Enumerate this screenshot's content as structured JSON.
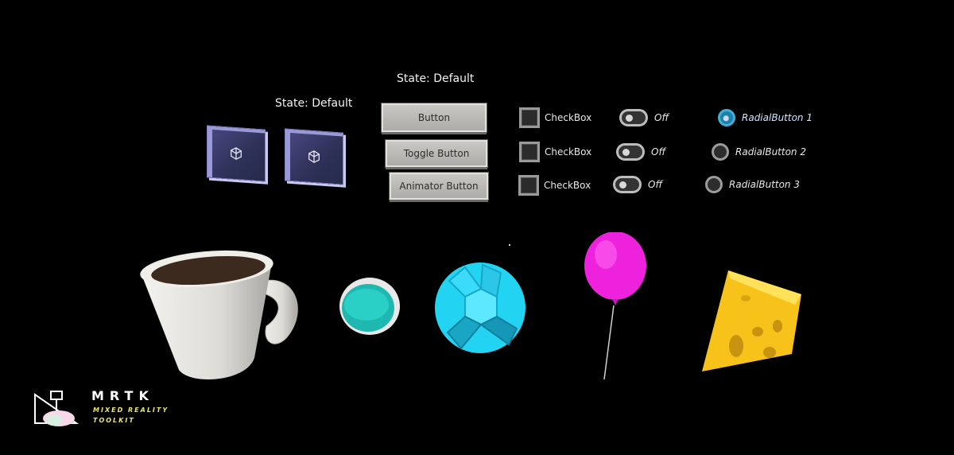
{
  "state_labels": {
    "tiles": "State: Default",
    "buttons": "State: Default"
  },
  "tiles": [
    {
      "icon": "cube-icon"
    },
    {
      "icon": "cube-icon"
    }
  ],
  "buttons": {
    "button": "Button",
    "toggle": "Toggle Button",
    "animator": "Animator Button"
  },
  "checkboxes": [
    "CheckBox",
    "CheckBox",
    "CheckBox"
  ],
  "toggles": [
    "Off",
    "Off",
    "Off"
  ],
  "radials": [
    {
      "label": "RadialButton 1",
      "selected": true
    },
    {
      "label": "RadialButton 2",
      "selected": false
    },
    {
      "label": "RadialButton 3",
      "selected": false
    }
  ],
  "objects": [
    "coffee-cup",
    "push-button",
    "icosphere",
    "balloon",
    "cheese"
  ],
  "logo": {
    "title": "MRTK",
    "subtitle_1": "MIXED REALITY",
    "subtitle_2": "TOOLKIT"
  },
  "colors": {
    "background": "#000000",
    "tile": "#2e3158",
    "button": "#bcbab7",
    "radial_active": "#1e7fa8",
    "teal_button": "#1fb8b0",
    "icosphere": "#22d4f2",
    "balloon": "#ee22dd",
    "cheese": "#f7c31b",
    "logo_accent": "#e8e57a"
  }
}
